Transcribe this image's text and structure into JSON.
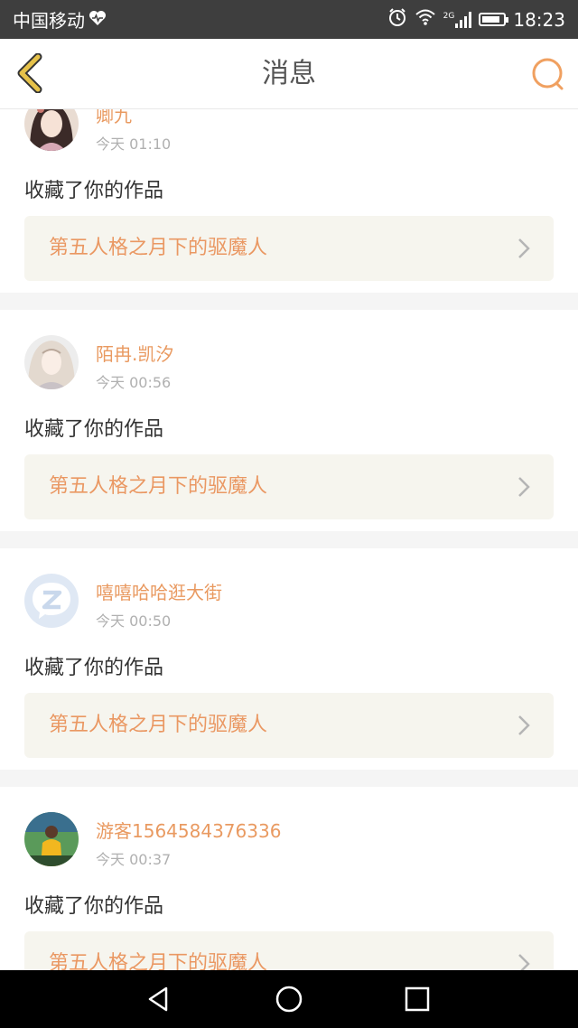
{
  "status_bar": {
    "carrier": "中国移动",
    "network": "2G",
    "time": "18:23"
  },
  "header": {
    "title": "消息"
  },
  "messages": [
    {
      "username": "卿九",
      "time": "今天 01:10",
      "action": "收藏了你的作品",
      "work_title": "第五人格之月下的驱魔人",
      "avatar": "anime-girl-avatar"
    },
    {
      "username": "陌冉.凯汐",
      "time": "今天 00:56",
      "action": "收藏了你的作品",
      "work_title": "第五人格之月下的驱魔人",
      "avatar": "anime-girl-avatar"
    },
    {
      "username": "嘻嘻哈哈逛大街",
      "time": "今天 00:50",
      "action": "收藏了你的作品",
      "work_title": "第五人格之月下的驱魔人",
      "avatar": "default-z-avatar"
    },
    {
      "username": "游客1564584376336",
      "time": "今天 00:37",
      "action": "收藏了你的作品",
      "work_title": "第五人格之月下的驱魔人",
      "avatar": "photo-avatar"
    }
  ],
  "colors": {
    "accent": "#e99a61",
    "work_bg": "#f6f5ee",
    "back_icon": "#e6c24a",
    "search_icon": "#f0a060"
  }
}
